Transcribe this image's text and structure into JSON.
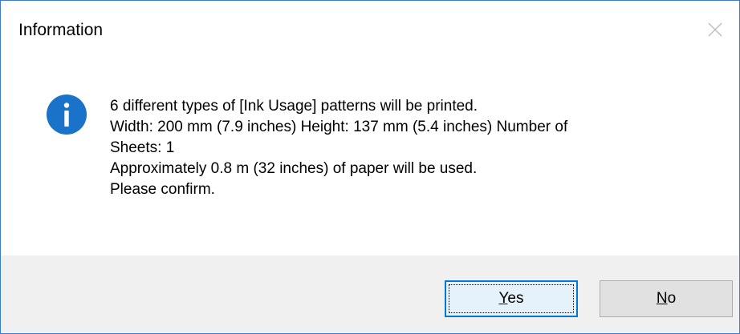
{
  "window": {
    "title": "Information",
    "close_icon": "close-icon"
  },
  "message": {
    "icon": "info-icon",
    "icon_color": "#1a73c9",
    "lines": [
      "6 different types of [Ink Usage] patterns will be printed.",
      "Width: 200 mm (7.9 inches) Height: 137 mm (5.4 inches) Number of",
      "Sheets: 1",
      "Approximately 0.8 m (32 inches) of paper will be used.",
      "Please confirm."
    ]
  },
  "buttons": {
    "yes": {
      "mnemonic": "Y",
      "rest": "es"
    },
    "no": {
      "mnemonic": "N",
      "rest": "o"
    }
  }
}
